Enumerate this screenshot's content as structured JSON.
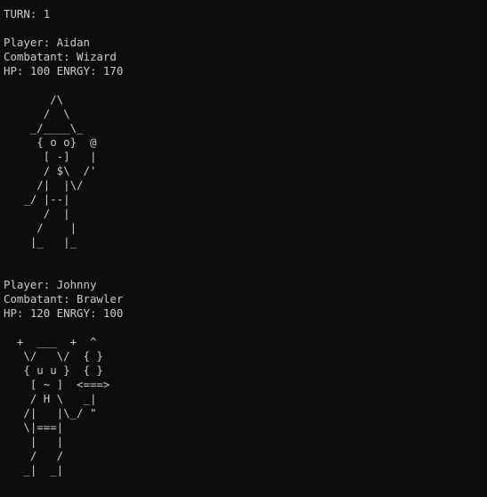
{
  "colors": {
    "background": "#0c0c0c",
    "text": "#cccccc"
  },
  "turn": "TURN: 1",
  "players": [
    {
      "player": "Player: Aidan",
      "combatant": "Combatant: Wizard",
      "stats": "HP: 100 ENRGY: 170",
      "art": [
        "",
        "       /\\",
        "      /  \\",
        "    _/____\\_",
        "     { o o}  @",
        "      [ -]   |",
        "      / $\\  /'",
        "     /|  |\\/",
        "   _/ |--|",
        "      /  |",
        "     /    |",
        "    |_   |_"
      ]
    },
    {
      "player": "Player: Johnny",
      "combatant": "Combatant: Brawler",
      "stats": "HP: 120 ENRGY: 100",
      "art": [
        "",
        "  +  ___  +  ^",
        "   \\/   \\/  { }",
        "   { u u }  { }",
        "    [ ~ ]  <===>",
        "    / H \\   _|",
        "   /|   |\\_/ \"",
        "   \\|===|",
        "    |   |",
        "    /   /",
        "   _|  _|"
      ]
    }
  ]
}
